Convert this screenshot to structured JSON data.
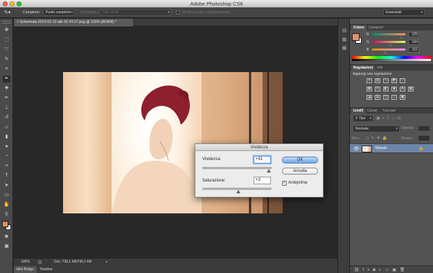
{
  "window": {
    "title": "Adobe Photoshop CS6"
  },
  "options_bar": {
    "campione_label": "Campione:",
    "campione_value": "Punto campione",
    "campione2_label": "Campione:",
    "campione2_value": "Tutti i livelli",
    "anello_label": "Mostra anello campionamento",
    "workspace": "Essenziali"
  },
  "document": {
    "tab_title": "Schermata 2013-02-19 alle 02.43.27.png @ 100% (RGB/8) *",
    "close_glyph": "×"
  },
  "status": {
    "zoom": "100%",
    "doc": "Doc: 736,1 KB/736,1 KB"
  },
  "bottom_tabs": [
    "Mini Bridge",
    "Timeline"
  ],
  "color_panel": {
    "tabs": [
      "Colore",
      "Campioni"
    ],
    "channels": [
      {
        "label": "R",
        "value": "225",
        "fraction": 0.88
      },
      {
        "label": "G",
        "value": "144",
        "fraction": 0.56
      },
      {
        "label": "B",
        "value": "101",
        "fraction": 0.4
      }
    ],
    "fg": "#e19065",
    "bg": "#ffffff"
  },
  "adjustments_panel": {
    "tabs": [
      "Regolazioni",
      "Stili"
    ],
    "heading": "Aggiungi una regolazione"
  },
  "layers_panel": {
    "tabs": [
      "Livelli",
      "Canali",
      "Tracciati"
    ],
    "filter": "Tipo",
    "blend": "Normale",
    "opacity_label": "Opacità:",
    "lock_label": "Bloc.:",
    "fill_label": "Riemp.:",
    "layer_name": "Sfondo"
  },
  "dialog": {
    "title": "Vividezza",
    "vividezza_label": "Vividezza:",
    "vividezza_value": "+91",
    "vividezza_level": 0.955,
    "saturazione_label": "Saturazione:",
    "saturazione_value": "+3",
    "saturazione_level": 0.515,
    "ok": "OK",
    "cancel": "Annulla",
    "preview_label": "Anteprima",
    "preview_checked": "✓"
  },
  "colors": {
    "accent": "#5b8ed6",
    "fg_swatch": "#e19065"
  }
}
